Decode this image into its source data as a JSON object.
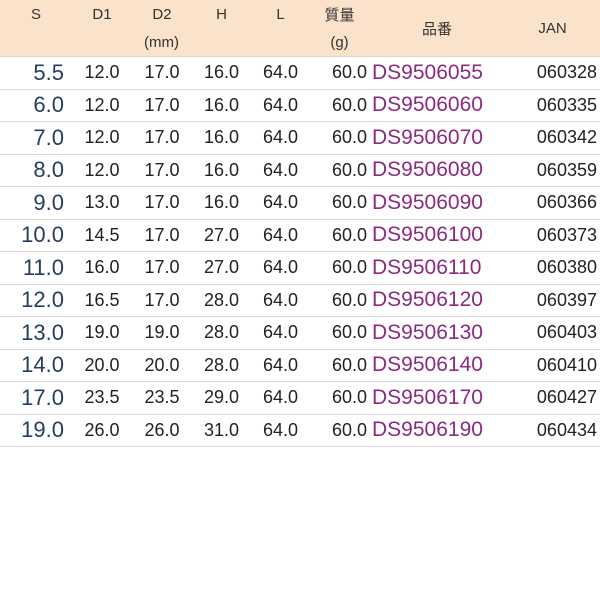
{
  "header": {
    "s": "S",
    "d1": "D1",
    "d2": "D2",
    "h": "H",
    "l": "L",
    "weight": "質量",
    "unit_mm": "(mm)",
    "unit_g": "(g)",
    "part_number": "品番",
    "jan": "JAN"
  },
  "rows": [
    {
      "s": "5.5",
      "d1": "12.0",
      "d2": "17.0",
      "h": "16.0",
      "l": "64.0",
      "weight": "60.0",
      "part_number": "DS9506055",
      "jan": "060328"
    },
    {
      "s": "6.0",
      "d1": "12.0",
      "d2": "17.0",
      "h": "16.0",
      "l": "64.0",
      "weight": "60.0",
      "part_number": "DS9506060",
      "jan": "060335"
    },
    {
      "s": "7.0",
      "d1": "12.0",
      "d2": "17.0",
      "h": "16.0",
      "l": "64.0",
      "weight": "60.0",
      "part_number": "DS9506070",
      "jan": "060342"
    },
    {
      "s": "8.0",
      "d1": "12.0",
      "d2": "17.0",
      "h": "16.0",
      "l": "64.0",
      "weight": "60.0",
      "part_number": "DS9506080",
      "jan": "060359"
    },
    {
      "s": "9.0",
      "d1": "13.0",
      "d2": "17.0",
      "h": "16.0",
      "l": "64.0",
      "weight": "60.0",
      "part_number": "DS9506090",
      "jan": "060366"
    },
    {
      "s": "10.0",
      "d1": "14.5",
      "d2": "17.0",
      "h": "27.0",
      "l": "64.0",
      "weight": "60.0",
      "part_number": "DS9506100",
      "jan": "060373"
    },
    {
      "s": "11.0",
      "d1": "16.0",
      "d2": "17.0",
      "h": "27.0",
      "l": "64.0",
      "weight": "60.0",
      "part_number": "DS9506110",
      "jan": "060380"
    },
    {
      "s": "12.0",
      "d1": "16.5",
      "d2": "17.0",
      "h": "28.0",
      "l": "64.0",
      "weight": "60.0",
      "part_number": "DS9506120",
      "jan": "060397"
    },
    {
      "s": "13.0",
      "d1": "19.0",
      "d2": "19.0",
      "h": "28.0",
      "l": "64.0",
      "weight": "60.0",
      "part_number": "DS9506130",
      "jan": "060403"
    },
    {
      "s": "14.0",
      "d1": "20.0",
      "d2": "20.0",
      "h": "28.0",
      "l": "64.0",
      "weight": "60.0",
      "part_number": "DS9506140",
      "jan": "060410"
    },
    {
      "s": "17.0",
      "d1": "23.5",
      "d2": "23.5",
      "h": "29.0",
      "l": "64.0",
      "weight": "60.0",
      "part_number": "DS9506170",
      "jan": "060427"
    },
    {
      "s": "19.0",
      "d1": "26.0",
      "d2": "26.0",
      "h": "31.0",
      "l": "64.0",
      "weight": "60.0",
      "part_number": "DS9506190",
      "jan": "060434"
    }
  ]
}
